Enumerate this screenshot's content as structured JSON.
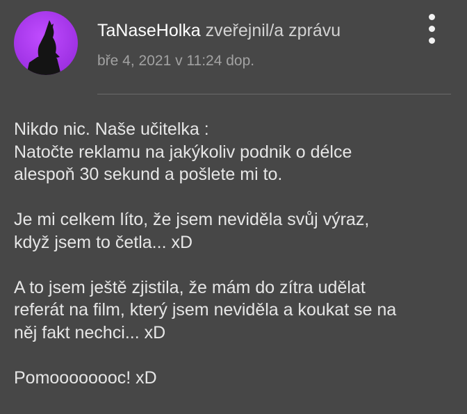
{
  "post": {
    "author": {
      "name": "TaNaseHolka",
      "avatar_icon": "howling-wolf-avatar-icon"
    },
    "action": "zveřejnil/a zprávu",
    "timestamp": "bře 4, 2021 v 11:24 dop.",
    "menu_icon": "more-vertical-icon",
    "body": [
      [
        "Nikdo nic. Naše učitelka :",
        "Natočte reklamu na jakýkoliv podnik o délce",
        "alespoň 30 sekund a pošlete mi to."
      ],
      [
        "Je mi celkem líto, že jsem neviděla svůj výraz,",
        "když jsem to četla... xD"
      ],
      [
        "A to jsem ještě zjistila, že mám do zítra udělat",
        "referát na film, který jsem neviděla a koukat se na",
        "něj fakt nechci... xD"
      ],
      [
        "Pomoooooooc! xD"
      ]
    ]
  },
  "colors": {
    "background": "#474747",
    "avatar_purple": "#b23cf0",
    "text": "#e6e6e6",
    "muted": "#a2a2a2"
  }
}
